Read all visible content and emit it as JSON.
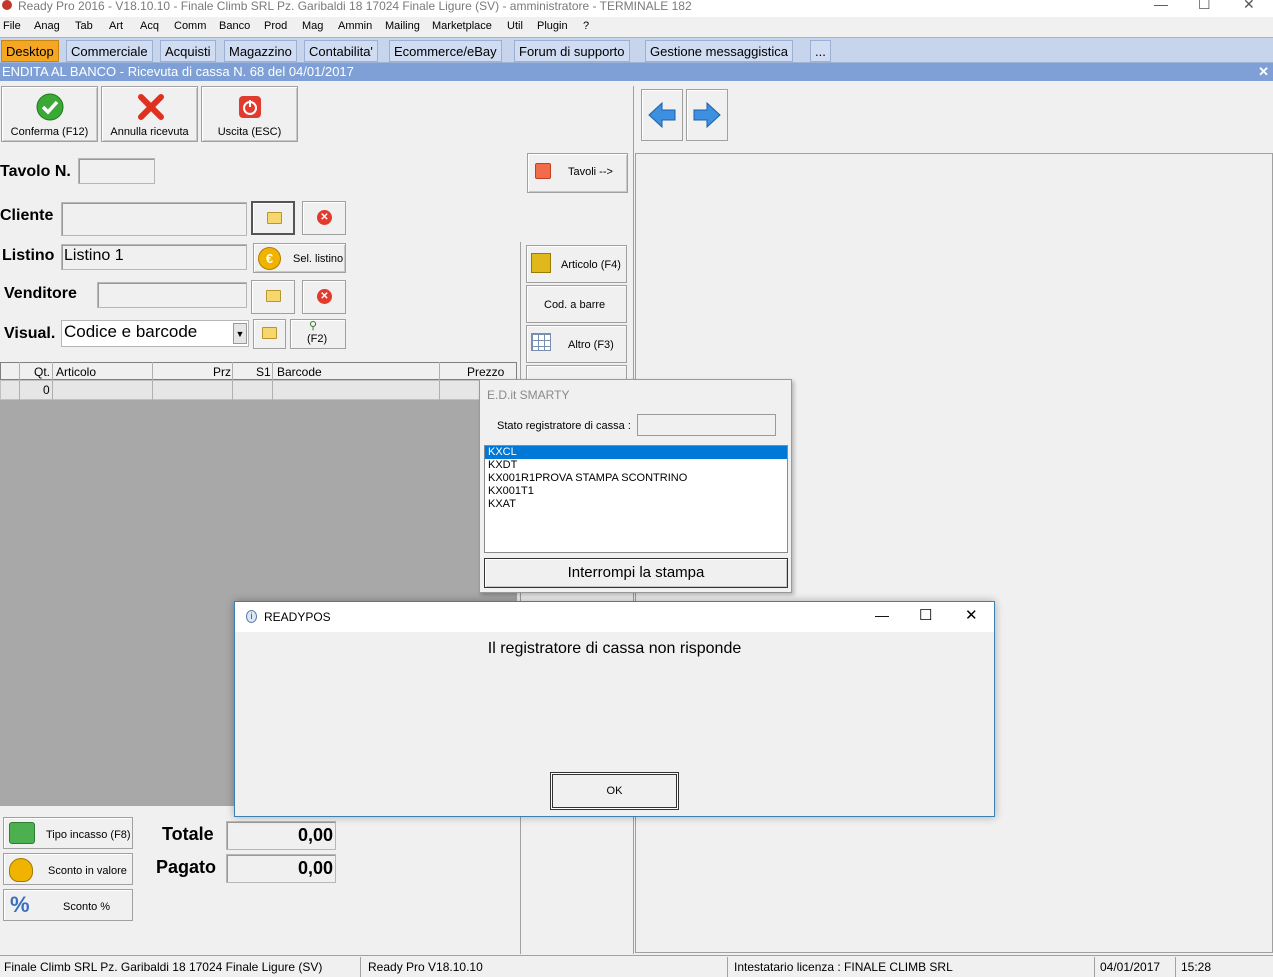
{
  "window": {
    "title": "Ready Pro 2016 - V18.10.10 - Finale Climb SRL Pz. Garibaldi 18 17024 Finale Ligure (SV)  - amministratore - TERMINALE 182"
  },
  "menu": [
    "File",
    "Anag",
    "Tab",
    "Art",
    "Acq",
    "Comm",
    "Banco",
    "Prod",
    "Mag",
    "Ammin",
    "Mailing",
    "Marketplace",
    "Util",
    "Plugin",
    "?"
  ],
  "tabs": [
    "Desktop",
    "Commerciale",
    "Acquisti",
    "Magazzino",
    "Contabilita'",
    "Ecommerce/eBay",
    "Forum di supporto",
    "Gestione messaggistica",
    "..."
  ],
  "subtitle": "ENDITA AL BANCO - Ricevuta di cassa N. 68 del 04/01/2017",
  "subtitle_close": "✕",
  "toolbar": {
    "confirm": "Conferma (F12)",
    "cancel": "Annulla ricevuta",
    "exit": "Uscita (ESC)"
  },
  "form": {
    "table_label": "Tavolo N.",
    "table_value": "",
    "tables_button": "Tavoli -->",
    "client_label": "Cliente",
    "client_value": "",
    "pricelist_label": "Listino",
    "pricelist_value": "Listino 1",
    "select_pricelist": "Sel. listino",
    "seller_label": "Venditore",
    "seller_value": "",
    "view_label": "Visual.",
    "view_value": "Codice e barcode",
    "f2_label": "(F2)"
  },
  "side_buttons": {
    "article": "Articolo (F4)",
    "barcode": "Cod. a barre",
    "other": "Altro (F3)"
  },
  "grid": {
    "columns": [
      "Qt.",
      "Articolo",
      "Prz",
      "S1",
      "Barcode",
      "Prezzo"
    ],
    "rows": [
      [
        "0",
        "",
        "",
        "",
        "",
        ""
      ]
    ]
  },
  "bottom": {
    "payment_type": "Tipo incasso (F8)",
    "discount_value": "Sconto in valore",
    "discount_pct": "Sconto %",
    "total_label": "Totale",
    "total_value": "0,00",
    "paid_label": "Pagato",
    "paid_value": "0,00"
  },
  "smarty": {
    "title": "E.D.it SMARTY",
    "status_label": "Stato registratore di cassa :",
    "status_value": "",
    "items": [
      "KXCL",
      "KXDT",
      "KX001R1PROVA STAMPA SCONTRINO",
      "KX001T1",
      "KXAT"
    ],
    "selected_index": 0,
    "stop_button": "Interrompi la stampa"
  },
  "dialog": {
    "title": "READYPOS",
    "message": "Il registratore di cassa non risponde",
    "ok": "OK"
  },
  "status": {
    "company": "Finale Climb SRL Pz. Garibaldi 18 17024 Finale Ligure (SV)",
    "version": "Ready Pro V18.10.10",
    "license": "Intestatario licenza : FINALE CLIMB SRL",
    "date": "04/01/2017",
    "time": "15:28"
  },
  "colors": {
    "active_tab": "#f5a623",
    "tab_bar": "#c6d4ec",
    "subtitle_bar": "#7fa0d6",
    "selection": "#0078d7",
    "grid_bg": "#a8a8a8"
  }
}
